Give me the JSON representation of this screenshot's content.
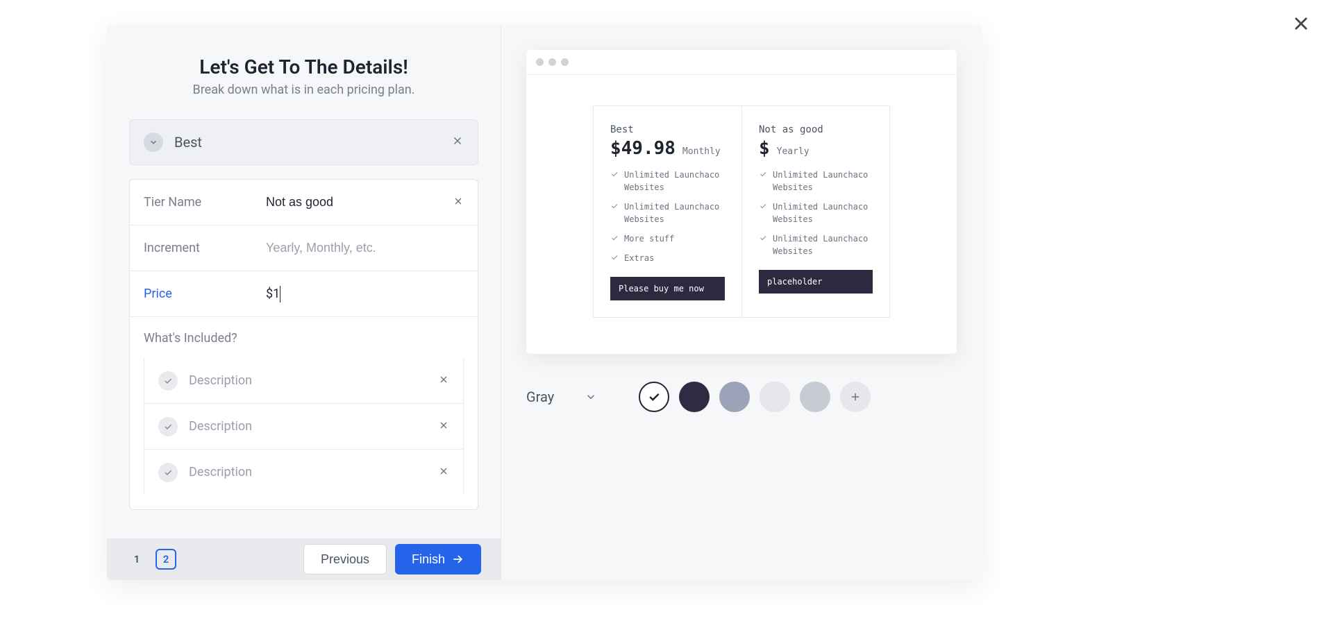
{
  "header": {
    "title": "Let's Get To The Details!",
    "subtitle": "Break down what is in each pricing plan."
  },
  "collapsed_tier": {
    "name": "Best"
  },
  "fields": {
    "tier_name_label": "Tier Name",
    "tier_name_value": "Not as good",
    "increment_label": "Increment",
    "increment_placeholder": "Yearly, Monthly, etc.",
    "price_label": "Price",
    "price_value": "$1"
  },
  "included": {
    "title": "What's Included?",
    "placeholder": "Description"
  },
  "footer": {
    "page1": "1",
    "page2": "2",
    "prev": "Previous",
    "finish": "Finish"
  },
  "preview": {
    "cards": [
      {
        "name": "Best",
        "price": "$49.98",
        "interval": "Monthly",
        "features": [
          "Unlimited Launchaco Websites",
          "Unlimited Launchaco Websites",
          "More stuff",
          "Extras"
        ],
        "cta": "Please buy me now"
      },
      {
        "name": "Not as good",
        "price": "$",
        "interval": "Yearly",
        "features": [
          "Unlimited Launchaco Websites",
          "Unlimited Launchaco Websites",
          "Unlimited Launchaco Websites"
        ],
        "cta": "placeholder"
      }
    ]
  },
  "palette": {
    "label": "Gray",
    "colors": [
      "#2e2c43",
      "#9ca3b8",
      "#e5e7eb",
      "#c7cbd4"
    ]
  }
}
